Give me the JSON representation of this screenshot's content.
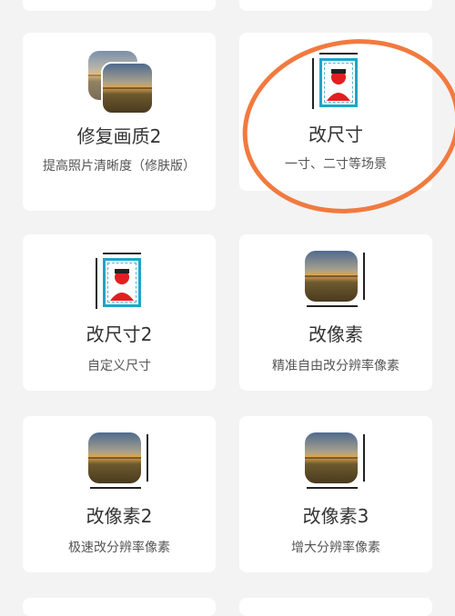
{
  "cards": [
    {
      "title": "修复画质2",
      "desc": "提高照片清晰度（修肤版）",
      "icon": "photo-stack-icon"
    },
    {
      "title": "改尺寸",
      "desc": "一寸、二寸等场景",
      "icon": "id-photo-icon"
    },
    {
      "title": "改尺寸2",
      "desc": "自定义尺寸",
      "icon": "id-photo-icon"
    },
    {
      "title": "改像素",
      "desc": "精准自由改分辨率像素",
      "icon": "pixel-resize-icon"
    },
    {
      "title": "改像素2",
      "desc": "极速改分辨率像素",
      "icon": "pixel-resize-icon"
    },
    {
      "title": "改像素3",
      "desc": "增大分辨率像素",
      "icon": "pixel-resize-icon"
    }
  ],
  "colors": {
    "highlight_ring": "#f17a3f",
    "id_border": "#21a3c9",
    "avatar_red": "#e02020"
  }
}
